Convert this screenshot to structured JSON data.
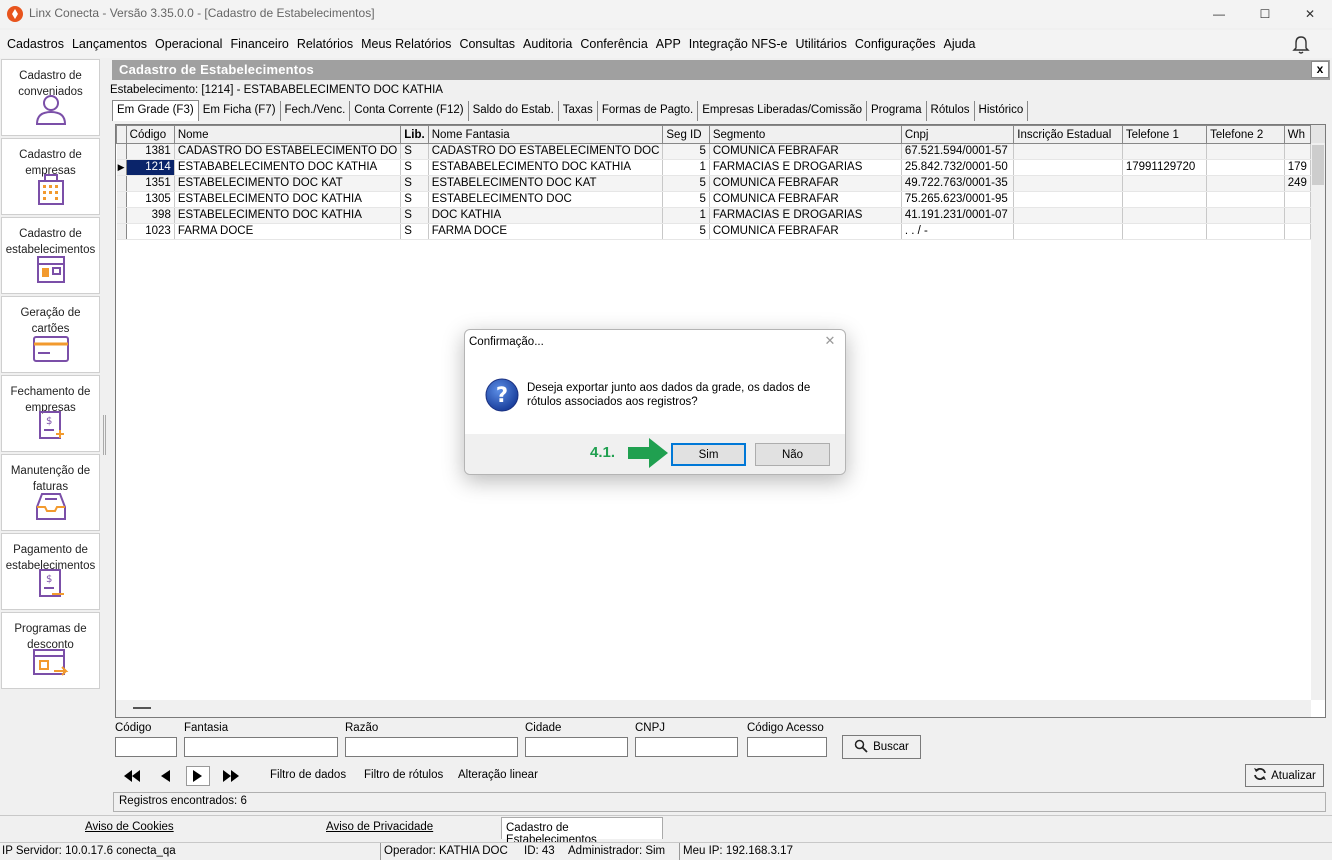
{
  "window": {
    "title": "Linx Conecta - Versão 3.35.0.0 - [Cadastro de Estabelecimentos]",
    "minimize": "—",
    "maximize": "☐",
    "close": "✕"
  },
  "menu": [
    "Cadastros",
    "Lançamentos",
    "Operacional",
    "Financeiro",
    "Relatórios",
    "Meus Relatórios",
    "Consultas",
    "Auditoria",
    "Conferência",
    "APP",
    "Integração NFS-e",
    "Utilitários",
    "Configurações",
    "Ajuda"
  ],
  "sidebar": [
    {
      "label": "Cadastro de conveniados",
      "icon": "user-icon"
    },
    {
      "label": "Cadastro de empresas",
      "icon": "building-icon"
    },
    {
      "label": "Cadastro de estabelecimentos",
      "icon": "store-icon"
    },
    {
      "label": "Geração de cartões",
      "icon": "card-icon"
    },
    {
      "label": "Fechamento de empresas",
      "icon": "invoice-close-icon"
    },
    {
      "label": "Manutenção de faturas",
      "icon": "inbox-icon"
    },
    {
      "label": "Pagamento de estabelecimentos",
      "icon": "payment-icon"
    },
    {
      "label": "Programas de desconto",
      "icon": "discount-program-icon"
    }
  ],
  "form": {
    "title": "Cadastro de Estabelecimentos",
    "close": "x",
    "estab_line": "Estabelecimento: [1214] - ESTABABELECIMENTO DOC KATHIA"
  },
  "tabs": [
    "Em Grade (F3)",
    "Em Ficha (F7)",
    "Fech./Venc.",
    "Conta Corrente (F12)",
    "Saldo do Estab.",
    "Taxas",
    "Formas de Pagto.",
    "Empresas Liberadas/Comissão",
    "Programa",
    "Rótulos",
    "Histórico"
  ],
  "grid": {
    "columns": [
      "Código",
      "Nome",
      "Lib.",
      "Nome Fantasia",
      "Seg ID",
      "Segmento",
      "Cnpj",
      "Inscrição Estadual",
      "Telefone 1",
      "Telefone 2",
      "Wh"
    ],
    "rows": [
      [
        "1381",
        "CADASTRO DO ESTABELECIMENTO DO",
        "S",
        "CADASTRO DO ESTABELECIMENTO DOC",
        "5",
        "COMUNICA FEBRAFAR",
        "67.521.594/0001-57",
        "",
        "",
        "",
        ""
      ],
      [
        "1214",
        "ESTABABELECIMENTO DOC KATHIA",
        "S",
        "ESTABABELECIMENTO DOC KATHIA",
        "1",
        "FARMACIAS E DROGARIAS",
        "25.842.732/0001-50",
        "",
        "17991129720",
        "",
        "179"
      ],
      [
        "1351",
        "ESTABELECIMENTO DOC KAT",
        "S",
        "ESTABELECIMENTO DOC KAT",
        "5",
        "COMUNICA FEBRAFAR",
        "49.722.763/0001-35",
        "",
        "",
        "",
        "249"
      ],
      [
        "1305",
        "ESTABELECIMENTO DOC KATHIA",
        "S",
        "ESTABELECIMENTO DOC",
        "5",
        "COMUNICA FEBRAFAR",
        "75.265.623/0001-95",
        "",
        "",
        "",
        ""
      ],
      [
        "398",
        "ESTABELECIMENTO DOC KATHIA",
        "S",
        "DOC KATHIA",
        "1",
        "FARMACIAS E DROGARIAS",
        "41.191.231/0001-07",
        "",
        "",
        "",
        ""
      ],
      [
        "1023",
        "FARMA DOCE",
        "S",
        "FARMA DOCE",
        "5",
        "COMUNICA FEBRAFAR",
        " .   .   /    -",
        "",
        "",
        "",
        ""
      ]
    ],
    "selected_row_index": 1,
    "row_indicator": "▶"
  },
  "filters": {
    "labels": [
      "Código",
      "Fantasia",
      "Razão",
      "Cidade",
      "CNPJ",
      "Código Acesso"
    ],
    "search_button": "Buscar"
  },
  "nav": {
    "links": [
      "Filtro de dados",
      "Filtro de rótulos",
      "Alteração linear"
    ],
    "refresh_button": "Atualizar"
  },
  "records": "Registros encontrados: 6",
  "bottom_tabs": [
    "Aviso de Cookies",
    "Aviso de Privacidade",
    "Cadastro de Estabelecimentos"
  ],
  "status": {
    "server": "IP Servidor: 10.0.17.6 conecta_qa",
    "operator": "Operador: KATHIA DOC",
    "id": "ID: 43",
    "admin": "Administrador: Sim",
    "ip": "Meu IP: 192.168.3.17"
  },
  "dialog": {
    "title": "Confirmação...",
    "close": "✕",
    "message": "Deseja exportar junto aos dados da grade, os dados de rótulos associados aos registros?",
    "yes": "Sim",
    "no": "Não",
    "step_label": "4.1."
  },
  "colors": {
    "accent": "#e8541d",
    "selection": "#0a246a",
    "arrow": "#20a050",
    "icon_purple": "#7b4fa8",
    "icon_orange": "#f29a2e"
  }
}
